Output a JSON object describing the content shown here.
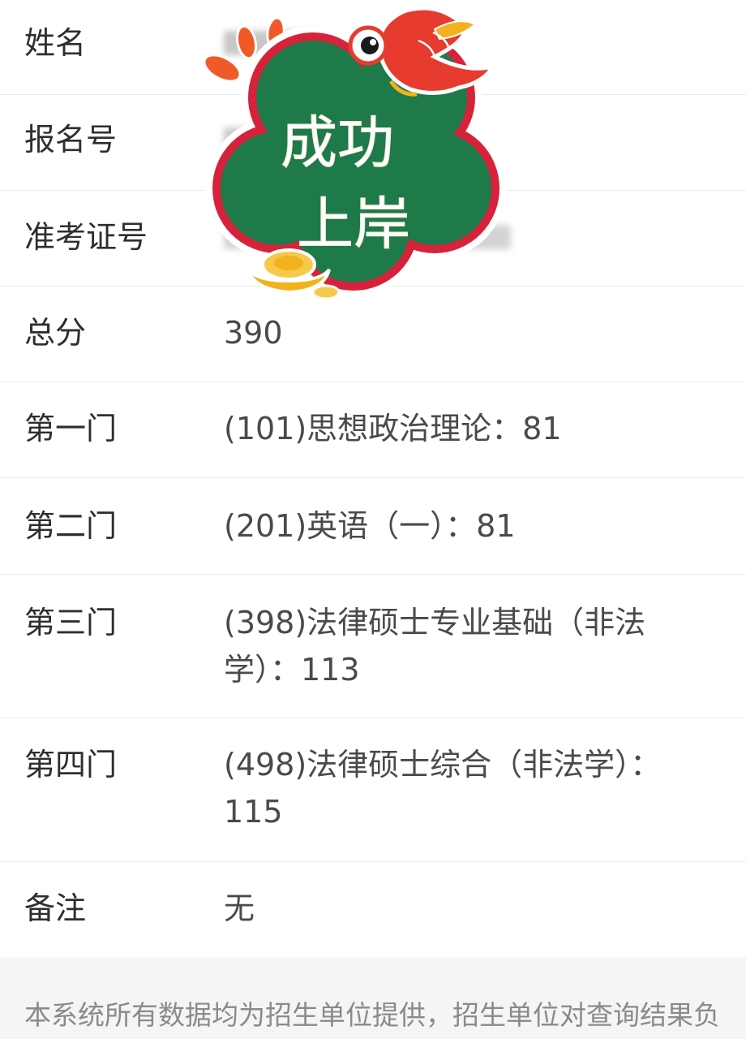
{
  "rows": [
    {
      "label": "姓名",
      "value": ""
    },
    {
      "label": "报名号",
      "value": ""
    },
    {
      "label": "准考证号",
      "value": ""
    },
    {
      "label": "总分",
      "value": "390"
    },
    {
      "label": "第一门",
      "value": "(101)思想政治理论：81"
    },
    {
      "label": "第二门",
      "value": "(201)英语（一）：81"
    },
    {
      "label": "第三门",
      "value": "(398)法律硕士专业基础（非法学）：113"
    },
    {
      "label": "第四门",
      "value": "(498)法律硕士综合（非法学）：115"
    },
    {
      "label": "备注",
      "value": "无"
    }
  ],
  "sticker": {
    "line1": "成功",
    "line2": "上岸",
    "colors": {
      "cloud": "#1f7a4a",
      "border": "#d6223a",
      "fish": "#e63b2e",
      "ingot": "#f2b21c"
    }
  },
  "footer": {
    "note": "本系统所有数据均为招生单位提供，招生单位对查询结果负责"
  }
}
